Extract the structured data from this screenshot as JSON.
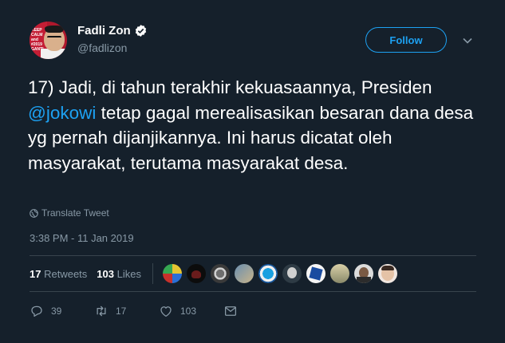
{
  "author": {
    "name": "Fadli Zon",
    "handle": "@fadlizon",
    "avatar_text": [
      "KEEP",
      "CALM",
      "and",
      "#2019",
      "GANTI"
    ]
  },
  "follow_label": "Follow",
  "tweet": {
    "text_before": "17) Jadi, di tahun terakhir kekuasaannya, Presiden ",
    "mention": "@jokowi",
    "text_after": " tetap gagal merealisasikan besaran dana desa yg pernah dijanjikannya. Ini harus dicatat oleh masyarakat, terutama masyarakat desa."
  },
  "translate_label": "Translate Tweet",
  "timestamp": "3:38 PM - 11 Jan 2019",
  "stats": {
    "retweets_count": "17",
    "retweets_label": "Retweets",
    "likes_count": "103",
    "likes_label": "Likes"
  },
  "actions": {
    "replies": "39",
    "retweets": "17",
    "likes": "103"
  },
  "icons": [
    "verified-icon",
    "chevron-down-icon",
    "globe-icon",
    "reply-icon",
    "retweet-icon",
    "like-icon",
    "message-icon"
  ],
  "colors": {
    "background": "#15202b",
    "accent": "#1da1f2",
    "muted": "#8899a6",
    "divider": "#38444d"
  }
}
